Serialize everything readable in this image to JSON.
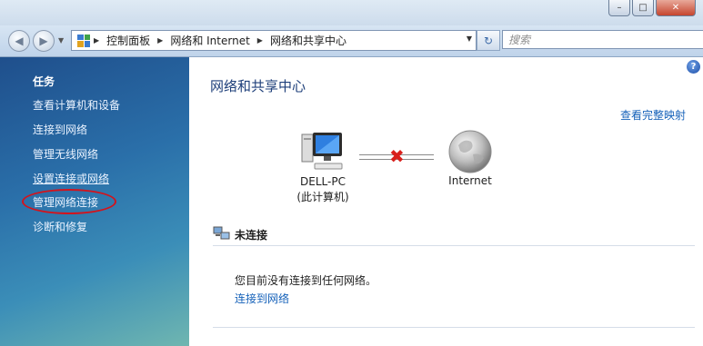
{
  "window": {
    "buttons": {
      "minimize": "–",
      "maximize": "□",
      "close": "✕"
    }
  },
  "navbar": {
    "back_icon": "◀",
    "forward_icon": "▶",
    "breadcrumbs": [
      "控制面板",
      "网络和 Internet",
      "网络和共享中心"
    ],
    "refresh_icon": "↻",
    "search_placeholder": "搜索"
  },
  "sidebar": {
    "title": "任务",
    "items": [
      {
        "label": "查看计算机和设备"
      },
      {
        "label": "连接到网络"
      },
      {
        "label": "管理无线网络"
      },
      {
        "label": "设置连接或网络"
      },
      {
        "label": "管理网络连接"
      },
      {
        "label": "诊断和修复"
      }
    ]
  },
  "main": {
    "title": "网络和共享中心",
    "view_full_map": "查看完整映射",
    "computer": {
      "name": "DELL-PC",
      "subtitle": "(此计算机)"
    },
    "internet": {
      "name": "Internet"
    },
    "status_icon": "✖",
    "section": {
      "title": "未连接",
      "message": "您目前没有连接到任何网络。",
      "link": "连接到网络"
    },
    "help_icon": "?"
  },
  "colors": {
    "sidebar_top": "#1f4f8c",
    "sidebar_bottom": "#6fb6b0",
    "link": "#1561b9",
    "title": "#1e3f7a",
    "error_x": "#d8201c",
    "highlight_ring": "#d2141d"
  }
}
